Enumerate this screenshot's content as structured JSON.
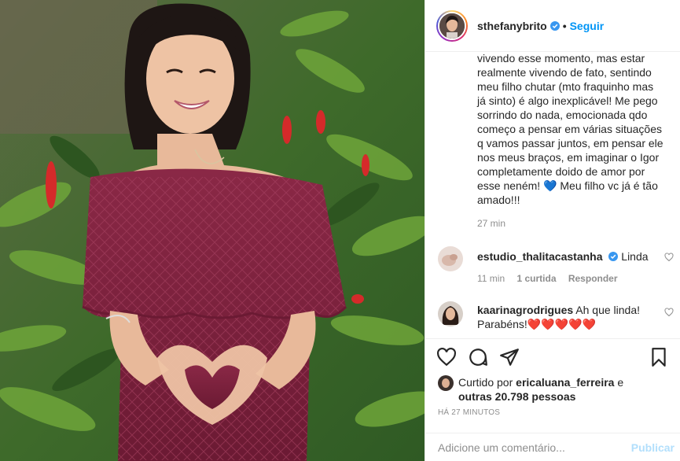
{
  "post": {
    "username": "sthefanybrito",
    "follow_label": "Seguir",
    "separator": "•",
    "caption_lines": [
      "vivendo esse momento, mas estar",
      "realmente vivendo de fato, sentindo",
      "meu filho chutar (mto fraquinho mas",
      "já sinto) é algo inexplicável! Me pego",
      "sorrindo do nada, emocionada qdo",
      "começo a pensar em várias situações",
      "q vamos passar juntos, em pensar ele",
      "nos meus braços, em imaginar o Igor",
      "completamente doido de amor por",
      "esse neném! 💙 Meu filho vc já é tão",
      "amado!!!"
    ],
    "caption_time": "27 min"
  },
  "comments": [
    {
      "username": "estudio_thalitacastanha",
      "text": "Linda",
      "verified": true,
      "time": "11 min",
      "likes": "1 curtida",
      "reply": "Responder"
    },
    {
      "username": "kaarinagrodrigues",
      "text": "Ah que linda! Parabéns!❤️❤️❤️❤️❤️",
      "verified": false
    }
  ],
  "liked_by": {
    "prefix": "Curtido por",
    "user": "ericaluana_ferreira",
    "conj": "e",
    "others": "outras 20.798 pessoas"
  },
  "posted_time": "HÁ 27 MINUTOS",
  "add_comment": {
    "placeholder": "Adicione um comentário...",
    "publish": "Publicar"
  },
  "colors": {
    "accent": "#0095f6",
    "publish_disabled": "#b2dffc",
    "dress": "#7a1f3d",
    "foliage": "#4a7a2e"
  },
  "icons": [
    "verified-icon",
    "heart-icon",
    "comment-icon",
    "share-icon",
    "bookmark-icon"
  ]
}
